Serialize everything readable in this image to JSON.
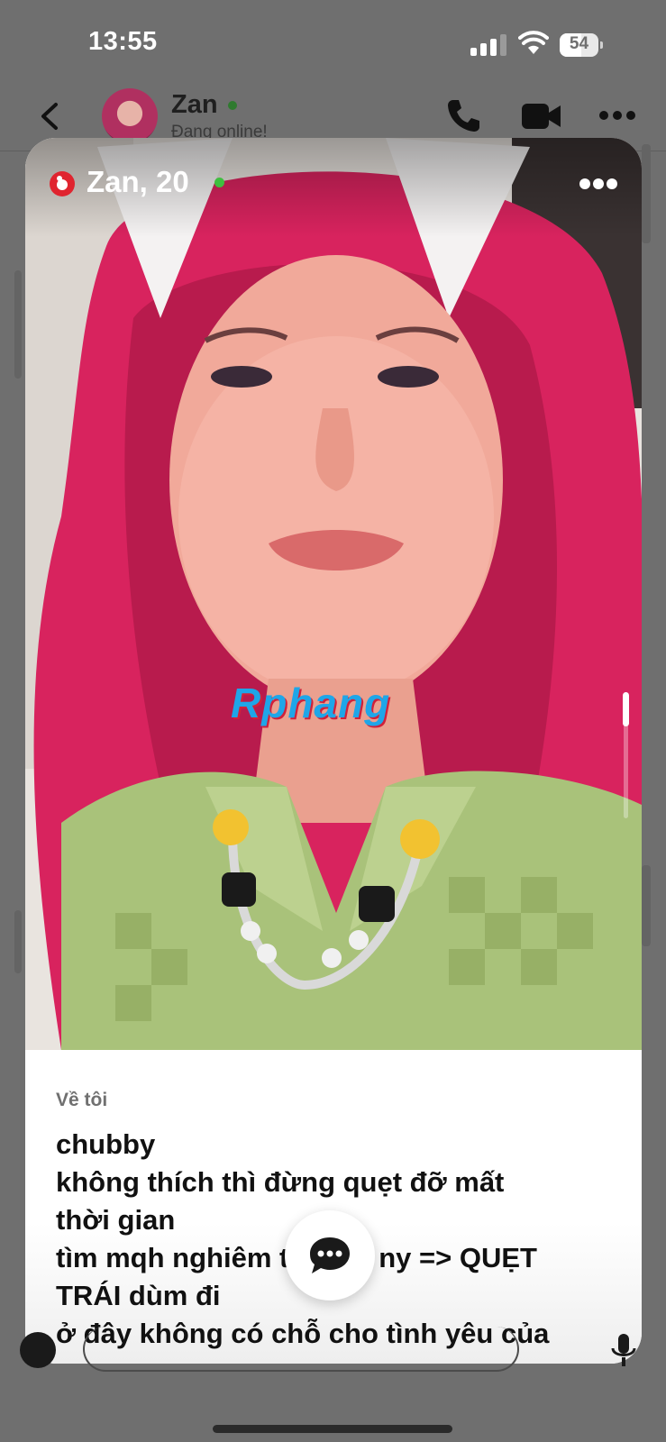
{
  "status_bar": {
    "time": "13:55",
    "battery": "54"
  },
  "chat_header": {
    "name": "Zan",
    "status": "Đang online!"
  },
  "profile": {
    "name": "Zan, 20",
    "watermark": "Rphang",
    "about_title": "Về tôi",
    "about_lines": [
      "chubby",
      "không thích thì đừng quẹt đỡ mất",
      "thời gian",
      "tìm mqh nghiêm túc tìm ny => QUẸT",
      "TRÁI dùm đi",
      "ở đây không có chỗ cho tình yêu của"
    ]
  },
  "colors": {
    "online": "#3fbf3f",
    "hair": "#d8235e",
    "shirt": "#a9c27a",
    "accent": "#e0242f"
  },
  "icons": [
    "back-icon",
    "phone-icon",
    "video-camera-icon",
    "more-icon",
    "brand-badge-icon",
    "chat-bubble-icon",
    "plus-icon",
    "mic-icon"
  ]
}
